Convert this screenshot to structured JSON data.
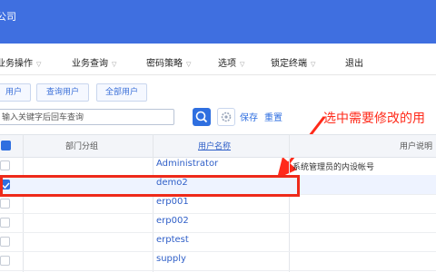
{
  "header": {
    "title": "公司"
  },
  "menu": [
    {
      "label": "业务操作"
    },
    {
      "label": "业务查询"
    },
    {
      "label": "密码策略"
    },
    {
      "label": "选项"
    },
    {
      "label": "锁定终端"
    },
    {
      "label": "退出"
    }
  ],
  "toolbar": {
    "btn1": "用户",
    "btn2": "查询用户",
    "btn3": "全部用户"
  },
  "search": {
    "placeholder": "输入关键字后回车查询",
    "save_label": "保存",
    "reset_label": "重置"
  },
  "callout": "选中需要修改的用",
  "table": {
    "headers": {
      "department": "部门分组",
      "username": "用户名称",
      "description": "用户说明"
    },
    "rows": [
      {
        "checked": false,
        "name": "Administrator",
        "desc": "系统管理员的内设帐号"
      },
      {
        "checked": true,
        "name": "demo2",
        "desc": ""
      },
      {
        "checked": false,
        "name": "erp001",
        "desc": ""
      },
      {
        "checked": false,
        "name": "erp002",
        "desc": ""
      },
      {
        "checked": false,
        "name": "erptest",
        "desc": ""
      },
      {
        "checked": false,
        "name": "supply",
        "desc": ""
      }
    ]
  },
  "colors": {
    "header_bg": "#3f6fe0",
    "accent": "#2f6fe0",
    "highlight": "#ee2a1a"
  }
}
